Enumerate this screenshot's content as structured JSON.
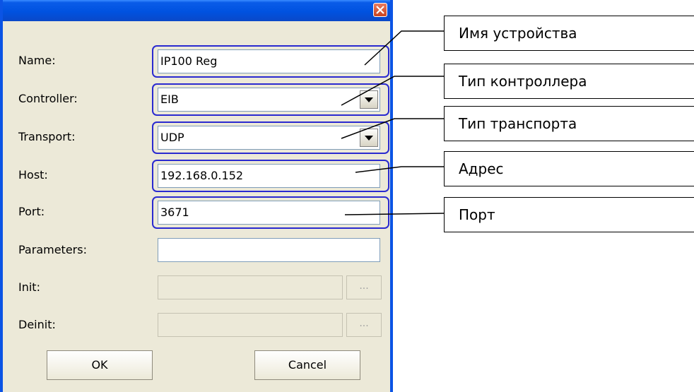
{
  "dialog": {
    "fields": [
      {
        "label": "Name:",
        "value": "IP100 Reg"
      },
      {
        "label": "Controller:",
        "value": "EIB"
      },
      {
        "label": "Transport:",
        "value": "UDP"
      },
      {
        "label": "Host:",
        "value": "192.168.0.152"
      },
      {
        "label": "Port:",
        "value": "3671"
      },
      {
        "label": "Parameters:",
        "value": ""
      },
      {
        "label": "Init:",
        "value": ""
      },
      {
        "label": "Deinit:",
        "value": ""
      }
    ],
    "dots_label": "...",
    "ok_label": "OK",
    "cancel_label": "Cancel"
  },
  "callouts": {
    "name": "Имя устройства",
    "controller": "Тип контроллера",
    "transport": "Тип транспорта",
    "host": "Адрес",
    "port": "Порт"
  },
  "colors": {
    "title_bar": "#0052e0",
    "highlight": "#2a2ad0",
    "close_button": "#c9431f"
  },
  "icons": {
    "close": "close-icon",
    "dropdown": "chevron-down-icon"
  }
}
